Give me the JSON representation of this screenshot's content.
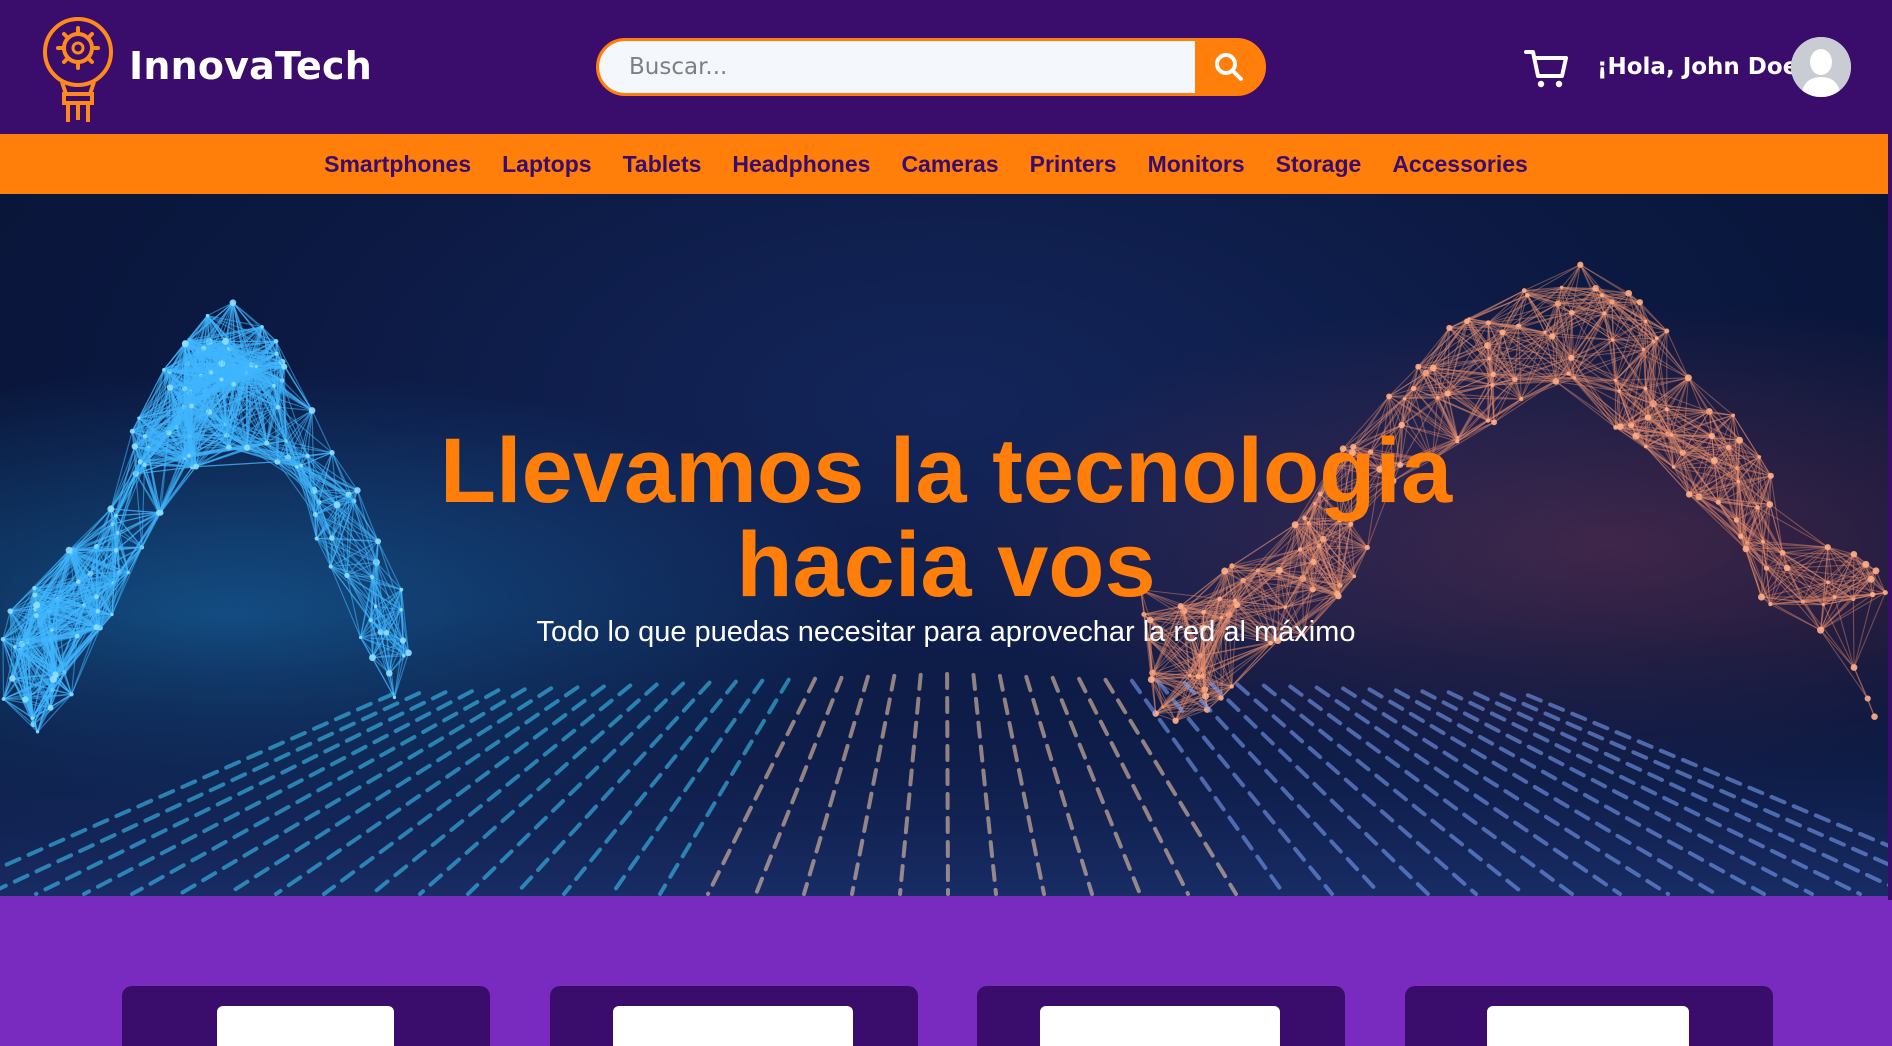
{
  "brand": {
    "name": "InnovaTech"
  },
  "search": {
    "placeholder": "Buscar..."
  },
  "user": {
    "greeting": "¡Hola, John Doe!"
  },
  "nav": {
    "items": [
      "Smartphones",
      "Laptops",
      "Tablets",
      "Headphones",
      "Cameras",
      "Printers",
      "Monitors",
      "Storage",
      "Accessories"
    ]
  },
  "hero": {
    "title_line1": "Llevamos la tecnologia",
    "title_line2": "hacia vos",
    "subtitle": "Todo lo que puedas necesitar para aprovechar la red al máximo"
  },
  "icons": {
    "logo": "lightbulb-gear-icon",
    "search": "search-icon",
    "cart": "cart-icon",
    "avatar": "user-avatar-icon"
  },
  "colors": {
    "header_bg": "#3a0c6b",
    "accent": "#ff7f0a",
    "page_bg": "#7a2bbf",
    "hero_bg": "#0b1840"
  }
}
